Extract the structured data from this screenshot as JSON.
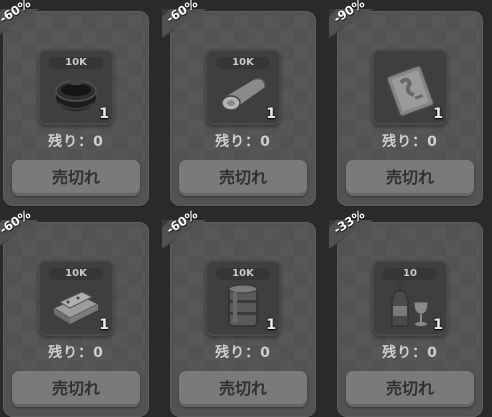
{
  "shop": {
    "items": [
      {
        "discount": "-60%",
        "amount": "10K",
        "qty": "1",
        "item": "cooking-pot-icon",
        "remain": "残り：0",
        "button": "売切れ"
      },
      {
        "discount": "-60%",
        "amount": "10K",
        "qty": "1",
        "item": "wood-log-icon",
        "remain": "残り：0",
        "button": "売切れ"
      },
      {
        "discount": "-90%",
        "amount": "",
        "qty": "1",
        "item": "blueprint-card-icon",
        "remain": "残り：0",
        "button": "売切れ"
      },
      {
        "discount": "-60%",
        "amount": "10K",
        "qty": "1",
        "item": "metal-plates-icon",
        "remain": "残り：0",
        "button": "売切れ"
      },
      {
        "discount": "-60%",
        "amount": "10K",
        "qty": "1",
        "item": "oil-barrel-icon",
        "remain": "残り：0",
        "button": "売切れ"
      },
      {
        "discount": "-33%",
        "amount": "10",
        "qty": "1",
        "item": "wine-bottle-glass-icon",
        "remain": "残り：0",
        "button": "売切れ"
      }
    ]
  },
  "colors": {
    "background": "#2a2a2a",
    "card": "#535353",
    "button": "#7a7a7a"
  }
}
